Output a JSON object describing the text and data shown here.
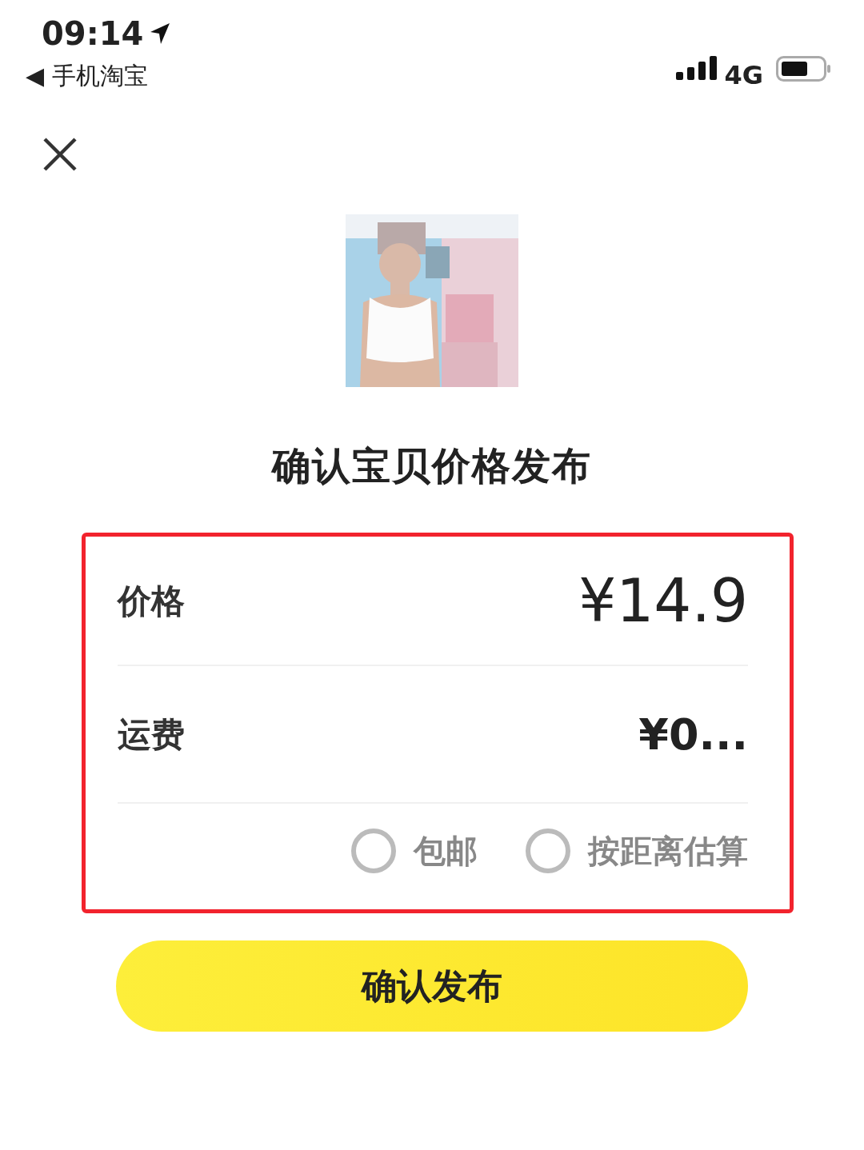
{
  "status_bar": {
    "time": "09:14",
    "back_app": "◀ 手机淘宝",
    "network": "4G"
  },
  "title": "确认宝贝价格发布",
  "fields": [
    {
      "label": "价格",
      "value": "¥14.9",
      "kind": "large"
    },
    {
      "label": "运费",
      "value": "¥0...",
      "kind": "normal"
    }
  ],
  "shipping_options": [
    {
      "label": "包邮",
      "selected": false
    },
    {
      "label": "按距离估算",
      "selected": false
    }
  ],
  "submit_button": "确认发布"
}
